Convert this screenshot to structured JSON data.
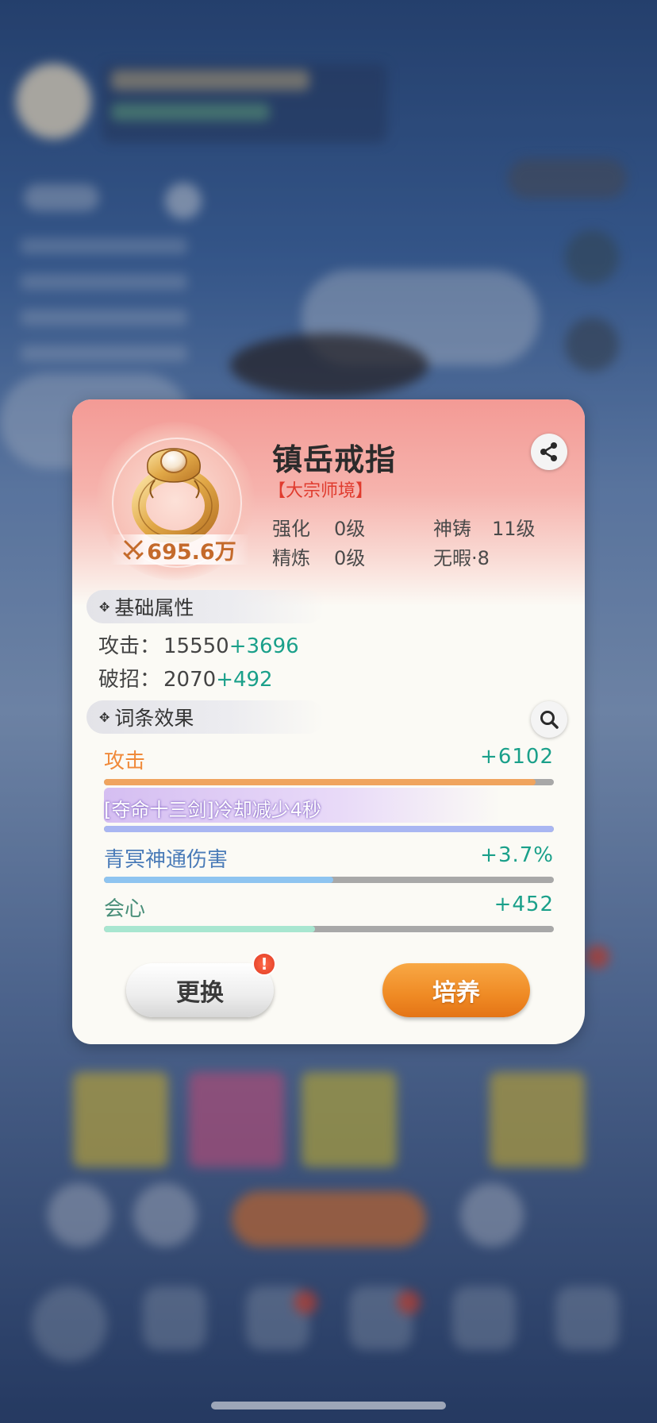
{
  "item": {
    "name": "镇岳戒指",
    "tier": "【大宗师境】",
    "power": "695.6万",
    "icon": "gold-ring-icon"
  },
  "stats": [
    {
      "label": "强化",
      "value": "0级"
    },
    {
      "label": "精炼",
      "value": "0级"
    },
    {
      "label": "神铸",
      "value": "11级"
    },
    {
      "label": "无暇·8",
      "value": ""
    }
  ],
  "sections": {
    "base_title": "基础属性",
    "effects_title": "词条效果"
  },
  "base_attrs": [
    {
      "label": "攻击：",
      "base": "15550",
      "bonus": "+3696"
    },
    {
      "label": "破招：",
      "base": "2070",
      "bonus": "+492"
    }
  ],
  "effects": [
    {
      "label": "攻击",
      "value": "+6102",
      "fill": 0.96,
      "label_color": "#f08a3a",
      "bar_color": "#f0a45e"
    },
    {
      "label": "[夺命十三剑]冷却减少4秒",
      "value": "",
      "fill": 1.0,
      "label_color": "#ffffff",
      "bar_color": "#a9b6f2"
    },
    {
      "label": "青冥神通伤害",
      "value": "+3.7%",
      "fill": 0.51,
      "label_color": "#4a7bb8",
      "bar_color": "#8ec4f0"
    },
    {
      "label": "会心",
      "value": "+452",
      "fill": 0.47,
      "label_color": "#4a8f7a",
      "bar_color": "#a8e6d0"
    }
  ],
  "buttons": {
    "replace": "更换",
    "train": "培养",
    "alert": "!"
  },
  "colors": {
    "accent_orange": "#ef8a24",
    "bonus_green": "#1aa08a",
    "tier_red": "#e03b2e"
  }
}
